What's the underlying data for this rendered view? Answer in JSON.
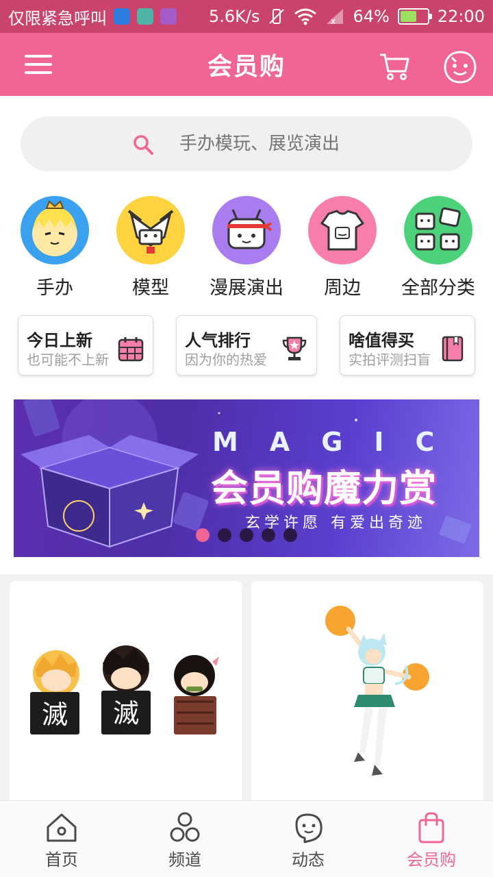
{
  "status_bar": {
    "carrier": "仅限紧急呼叫",
    "speed": "5.6K/s",
    "battery": "64%",
    "battery_level": 0.64,
    "time": "22:00"
  },
  "header": {
    "title": "会员购"
  },
  "search": {
    "placeholder": "手办模玩、展览演出"
  },
  "categories": [
    {
      "label": "手办",
      "icon": "figure-icon"
    },
    {
      "label": "模型",
      "icon": "model-icon"
    },
    {
      "label": "漫展演出",
      "icon": "expo-icon"
    },
    {
      "label": "周边",
      "icon": "merch-icon"
    },
    {
      "label": "全部分类",
      "icon": "all-categories-icon"
    }
  ],
  "features": [
    {
      "title": "今日上新",
      "subtitle": "也可能不上新",
      "icon": "calendar-icon"
    },
    {
      "title": "人气排行",
      "subtitle": "因为你的热爱",
      "icon": "trophy-icon"
    },
    {
      "title": "啥值得买",
      "subtitle": "实拍评测扫盲",
      "icon": "book-icon"
    }
  ],
  "banner": {
    "magic": "MAGIC",
    "title": "会员购魔力赏",
    "slogan": "玄学许愿 有爱出奇迹",
    "slides": 5,
    "active_slide": 1
  },
  "bottom_nav": [
    {
      "label": "首页",
      "icon": "home-icon"
    },
    {
      "label": "频道",
      "icon": "channel-icon"
    },
    {
      "label": "动态",
      "icon": "dynamic-icon"
    },
    {
      "label": "会员购",
      "icon": "shopping-bag-icon",
      "active": true
    }
  ],
  "colors": {
    "accent": "#f06595",
    "status_bar": "#c9436d"
  }
}
